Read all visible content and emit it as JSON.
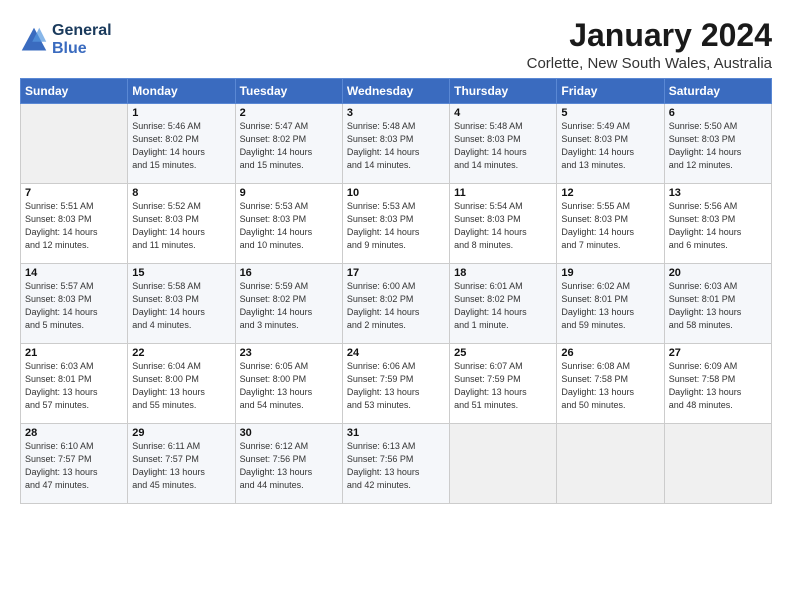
{
  "header": {
    "logo_line1": "General",
    "logo_line2": "Blue",
    "title": "January 2024",
    "location": "Corlette, New South Wales, Australia"
  },
  "days_of_week": [
    "Sunday",
    "Monday",
    "Tuesday",
    "Wednesday",
    "Thursday",
    "Friday",
    "Saturday"
  ],
  "weeks": [
    [
      {
        "day": "",
        "info": ""
      },
      {
        "day": "1",
        "info": "Sunrise: 5:46 AM\nSunset: 8:02 PM\nDaylight: 14 hours\nand 15 minutes."
      },
      {
        "day": "2",
        "info": "Sunrise: 5:47 AM\nSunset: 8:02 PM\nDaylight: 14 hours\nand 15 minutes."
      },
      {
        "day": "3",
        "info": "Sunrise: 5:48 AM\nSunset: 8:03 PM\nDaylight: 14 hours\nand 14 minutes."
      },
      {
        "day": "4",
        "info": "Sunrise: 5:48 AM\nSunset: 8:03 PM\nDaylight: 14 hours\nand 14 minutes."
      },
      {
        "day": "5",
        "info": "Sunrise: 5:49 AM\nSunset: 8:03 PM\nDaylight: 14 hours\nand 13 minutes."
      },
      {
        "day": "6",
        "info": "Sunrise: 5:50 AM\nSunset: 8:03 PM\nDaylight: 14 hours\nand 12 minutes."
      }
    ],
    [
      {
        "day": "7",
        "info": "Sunrise: 5:51 AM\nSunset: 8:03 PM\nDaylight: 14 hours\nand 12 minutes."
      },
      {
        "day": "8",
        "info": "Sunrise: 5:52 AM\nSunset: 8:03 PM\nDaylight: 14 hours\nand 11 minutes."
      },
      {
        "day": "9",
        "info": "Sunrise: 5:53 AM\nSunset: 8:03 PM\nDaylight: 14 hours\nand 10 minutes."
      },
      {
        "day": "10",
        "info": "Sunrise: 5:53 AM\nSunset: 8:03 PM\nDaylight: 14 hours\nand 9 minutes."
      },
      {
        "day": "11",
        "info": "Sunrise: 5:54 AM\nSunset: 8:03 PM\nDaylight: 14 hours\nand 8 minutes."
      },
      {
        "day": "12",
        "info": "Sunrise: 5:55 AM\nSunset: 8:03 PM\nDaylight: 14 hours\nand 7 minutes."
      },
      {
        "day": "13",
        "info": "Sunrise: 5:56 AM\nSunset: 8:03 PM\nDaylight: 14 hours\nand 6 minutes."
      }
    ],
    [
      {
        "day": "14",
        "info": "Sunrise: 5:57 AM\nSunset: 8:03 PM\nDaylight: 14 hours\nand 5 minutes."
      },
      {
        "day": "15",
        "info": "Sunrise: 5:58 AM\nSunset: 8:03 PM\nDaylight: 14 hours\nand 4 minutes."
      },
      {
        "day": "16",
        "info": "Sunrise: 5:59 AM\nSunset: 8:02 PM\nDaylight: 14 hours\nand 3 minutes."
      },
      {
        "day": "17",
        "info": "Sunrise: 6:00 AM\nSunset: 8:02 PM\nDaylight: 14 hours\nand 2 minutes."
      },
      {
        "day": "18",
        "info": "Sunrise: 6:01 AM\nSunset: 8:02 PM\nDaylight: 14 hours\nand 1 minute."
      },
      {
        "day": "19",
        "info": "Sunrise: 6:02 AM\nSunset: 8:01 PM\nDaylight: 13 hours\nand 59 minutes."
      },
      {
        "day": "20",
        "info": "Sunrise: 6:03 AM\nSunset: 8:01 PM\nDaylight: 13 hours\nand 58 minutes."
      }
    ],
    [
      {
        "day": "21",
        "info": "Sunrise: 6:03 AM\nSunset: 8:01 PM\nDaylight: 13 hours\nand 57 minutes."
      },
      {
        "day": "22",
        "info": "Sunrise: 6:04 AM\nSunset: 8:00 PM\nDaylight: 13 hours\nand 55 minutes."
      },
      {
        "day": "23",
        "info": "Sunrise: 6:05 AM\nSunset: 8:00 PM\nDaylight: 13 hours\nand 54 minutes."
      },
      {
        "day": "24",
        "info": "Sunrise: 6:06 AM\nSunset: 7:59 PM\nDaylight: 13 hours\nand 53 minutes."
      },
      {
        "day": "25",
        "info": "Sunrise: 6:07 AM\nSunset: 7:59 PM\nDaylight: 13 hours\nand 51 minutes."
      },
      {
        "day": "26",
        "info": "Sunrise: 6:08 AM\nSunset: 7:58 PM\nDaylight: 13 hours\nand 50 minutes."
      },
      {
        "day": "27",
        "info": "Sunrise: 6:09 AM\nSunset: 7:58 PM\nDaylight: 13 hours\nand 48 minutes."
      }
    ],
    [
      {
        "day": "28",
        "info": "Sunrise: 6:10 AM\nSunset: 7:57 PM\nDaylight: 13 hours\nand 47 minutes."
      },
      {
        "day": "29",
        "info": "Sunrise: 6:11 AM\nSunset: 7:57 PM\nDaylight: 13 hours\nand 45 minutes."
      },
      {
        "day": "30",
        "info": "Sunrise: 6:12 AM\nSunset: 7:56 PM\nDaylight: 13 hours\nand 44 minutes."
      },
      {
        "day": "31",
        "info": "Sunrise: 6:13 AM\nSunset: 7:56 PM\nDaylight: 13 hours\nand 42 minutes."
      },
      {
        "day": "",
        "info": ""
      },
      {
        "day": "",
        "info": ""
      },
      {
        "day": "",
        "info": ""
      }
    ]
  ]
}
